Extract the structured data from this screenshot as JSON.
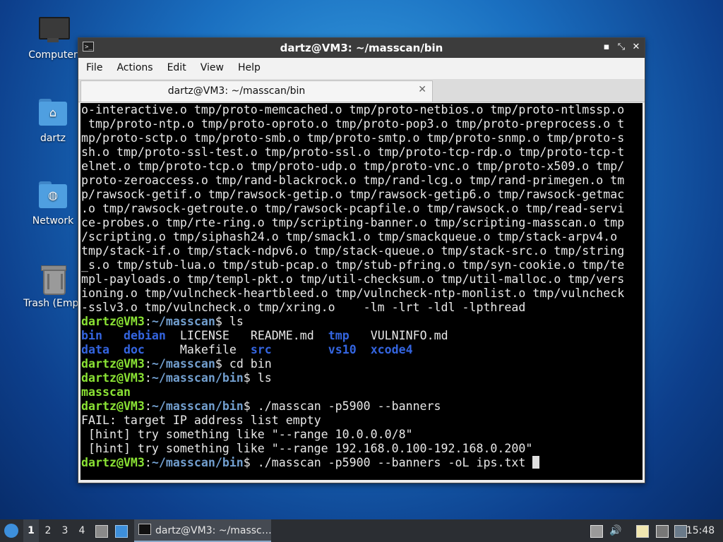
{
  "desktop": {
    "icons": [
      {
        "label": "Computer"
      },
      {
        "label": "dartz"
      },
      {
        "label": "Network"
      },
      {
        "label": "Trash (Empt"
      }
    ]
  },
  "window": {
    "title": "dartz@VM3: ~/masscan/bin",
    "menu": [
      "File",
      "Actions",
      "Edit",
      "View",
      "Help"
    ],
    "tab_label": "dartz@VM3: ~/masscan/bin",
    "tab_close": "✕",
    "controls": {
      "minimize": "▪",
      "maximize": "⤡",
      "close": "✕"
    }
  },
  "terminal": {
    "wrapped_output": [
      "o-interactive.o tmp/proto-memcached.o tmp/proto-netbios.o tmp/proto-ntlmssp.o",
      " tmp/proto-ntp.o tmp/proto-oproto.o tmp/proto-pop3.o tmp/proto-preprocess.o t",
      "mp/proto-sctp.o tmp/proto-smb.o tmp/proto-smtp.o tmp/proto-snmp.o tmp/proto-s",
      "sh.o tmp/proto-ssl-test.o tmp/proto-ssl.o tmp/proto-tcp-rdp.o tmp/proto-tcp-t",
      "elnet.o tmp/proto-tcp.o tmp/proto-udp.o tmp/proto-vnc.o tmp/proto-x509.o tmp/",
      "proto-zeroaccess.o tmp/rand-blackrock.o tmp/rand-lcg.o tmp/rand-primegen.o tm",
      "p/rawsock-getif.o tmp/rawsock-getip.o tmp/rawsock-getip6.o tmp/rawsock-getmac",
      ".o tmp/rawsock-getroute.o tmp/rawsock-pcapfile.o tmp/rawsock.o tmp/read-servi",
      "ce-probes.o tmp/rte-ring.o tmp/scripting-banner.o tmp/scripting-masscan.o tmp",
      "/scripting.o tmp/siphash24.o tmp/smack1.o tmp/smackqueue.o tmp/stack-arpv4.o",
      "tmp/stack-if.o tmp/stack-ndpv6.o tmp/stack-queue.o tmp/stack-src.o tmp/string",
      "_s.o tmp/stub-lua.o tmp/stub-pcap.o tmp/stub-pfring.o tmp/syn-cookie.o tmp/te",
      "mpl-payloads.o tmp/templ-pkt.o tmp/util-checksum.o tmp/util-malloc.o tmp/vers",
      "ioning.o tmp/vulncheck-heartbleed.o tmp/vulncheck-ntp-monlist.o tmp/vulncheck",
      "-sslv3.o tmp/vulncheck.o tmp/xring.o    -lm -lrt -ldl -lpthread"
    ],
    "prompt_user": "dartz@VM3",
    "colon": ":",
    "path_masscan": "~/masscan",
    "path_bin": "~/masscan/bin",
    "dollar": "$ ",
    "cmd_ls": "ls",
    "cmd_cd": "cd bin",
    "cmd_banners": "./masscan -p5900 --banners",
    "cmd_banners_ol": "./masscan -p5900 --banners -oL ips.txt ",
    "ls_row1": {
      "a": "bin",
      "b": "debian",
      "c": "LICENSE",
      "d": "README.md",
      "e": "tmp",
      "f": "VULNINFO.md"
    },
    "ls_row2": {
      "a": "data",
      "b": "doc",
      "c": "Makefile",
      "d": "src",
      "e": "vs10",
      "f": "xcode4"
    },
    "ls_bin": "masscan",
    "fail_line": "FAIL: target IP address list empty",
    "hint1": " [hint] try something like \"--range 10.0.0.0/8\"",
    "hint2": " [hint] try something like \"--range 192.168.0.100-192.168.0.200\""
  },
  "taskbar": {
    "workspaces": [
      "1",
      "2",
      "3",
      "4"
    ],
    "active_workspace": "1",
    "task_label": "dartz@VM3: ~/massc…",
    "clock": "15:48"
  }
}
